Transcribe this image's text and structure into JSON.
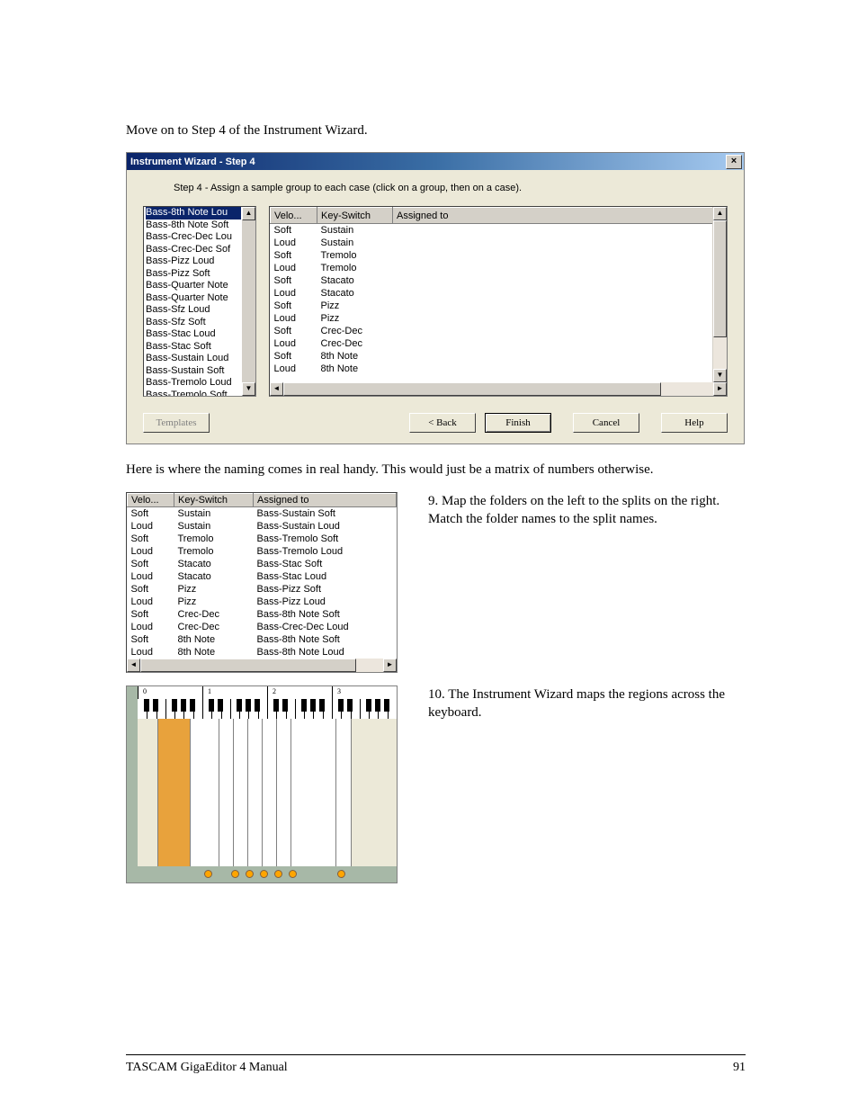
{
  "intro_text": "Move on to Step 4 of the Instrument Wizard.",
  "wizard": {
    "title": "Instrument Wizard - Step 4",
    "instruction": "Step 4 - Assign a sample group to each case (click on a group, then on a case).",
    "group_list": [
      "Bass-8th Note Lou",
      "Bass-8th Note Soft",
      "Bass-Crec-Dec Lou",
      "Bass-Crec-Dec Sof",
      "Bass-Pizz Loud",
      "Bass-Pizz Soft",
      "Bass-Quarter Note",
      "Bass-Quarter Note",
      "Bass-Sfz Loud",
      "Bass-Sfz Soft",
      "Bass-Stac Loud",
      "Bass-Stac Soft",
      "Bass-Sustain Loud",
      "Bass-Sustain Soft",
      "Bass-Tremolo Loud",
      "Bass-Tremolo Soft"
    ],
    "selected_group_index": 0,
    "case_headers": [
      "Velo...",
      "Key-Switch",
      "Assigned to"
    ],
    "case_rows": [
      [
        "Soft",
        "Sustain",
        ""
      ],
      [
        "Loud",
        "Sustain",
        ""
      ],
      [
        "Soft",
        "Tremolo",
        ""
      ],
      [
        "Loud",
        "Tremolo",
        ""
      ],
      [
        "Soft",
        "Stacato",
        ""
      ],
      [
        "Loud",
        "Stacato",
        ""
      ],
      [
        "Soft",
        "Pizz",
        ""
      ],
      [
        "Loud",
        "Pizz",
        ""
      ],
      [
        "Soft",
        "Crec-Dec",
        ""
      ],
      [
        "Loud",
        "Crec-Dec",
        ""
      ],
      [
        "Soft",
        "8th Note",
        ""
      ],
      [
        "Loud",
        "8th Note",
        ""
      ]
    ],
    "buttons": {
      "templates": "Templates",
      "back": "< Back",
      "finish": "Finish",
      "cancel": "Cancel",
      "help": "Help"
    }
  },
  "mid_text": "Here is where the naming comes in real handy. This would just be a matrix of numbers otherwise.",
  "assigned_table": {
    "headers": [
      "Velo...",
      "Key-Switch",
      "Assigned to"
    ],
    "rows": [
      [
        "Soft",
        "Sustain",
        "Bass-Sustain Soft"
      ],
      [
        "Loud",
        "Sustain",
        "Bass-Sustain Loud"
      ],
      [
        "Soft",
        "Tremolo",
        "Bass-Tremolo Soft"
      ],
      [
        "Loud",
        "Tremolo",
        "Bass-Tremolo Loud"
      ],
      [
        "Soft",
        "Stacato",
        "Bass-Stac Soft"
      ],
      [
        "Loud",
        "Stacato",
        "Bass-Stac Loud"
      ],
      [
        "Soft",
        "Pizz",
        "Bass-Pizz Soft"
      ],
      [
        "Loud",
        "Pizz",
        "Bass-Pizz Loud"
      ],
      [
        "Soft",
        "Crec-Dec",
        "Bass-8th Note Soft"
      ],
      [
        "Loud",
        "Crec-Dec",
        "Bass-Crec-Dec Loud"
      ],
      [
        "Soft",
        "8th Note",
        "Bass-8th Note Soft"
      ],
      [
        "Loud",
        "8th Note",
        "Bass-8th Note Loud"
      ]
    ]
  },
  "step9_text": "9. Map the folders on the left to the splits on the right.  Match the folder names to the split names.",
  "step10_text": "10. The Instrument Wizard maps the regions across the keyboard.",
  "keyboard": {
    "octave_labels": [
      "0",
      "1",
      "2",
      "3"
    ],
    "selected_region_index": 0
  },
  "footer": {
    "left": "TASCAM GigaEditor 4 Manual",
    "right": "91"
  }
}
